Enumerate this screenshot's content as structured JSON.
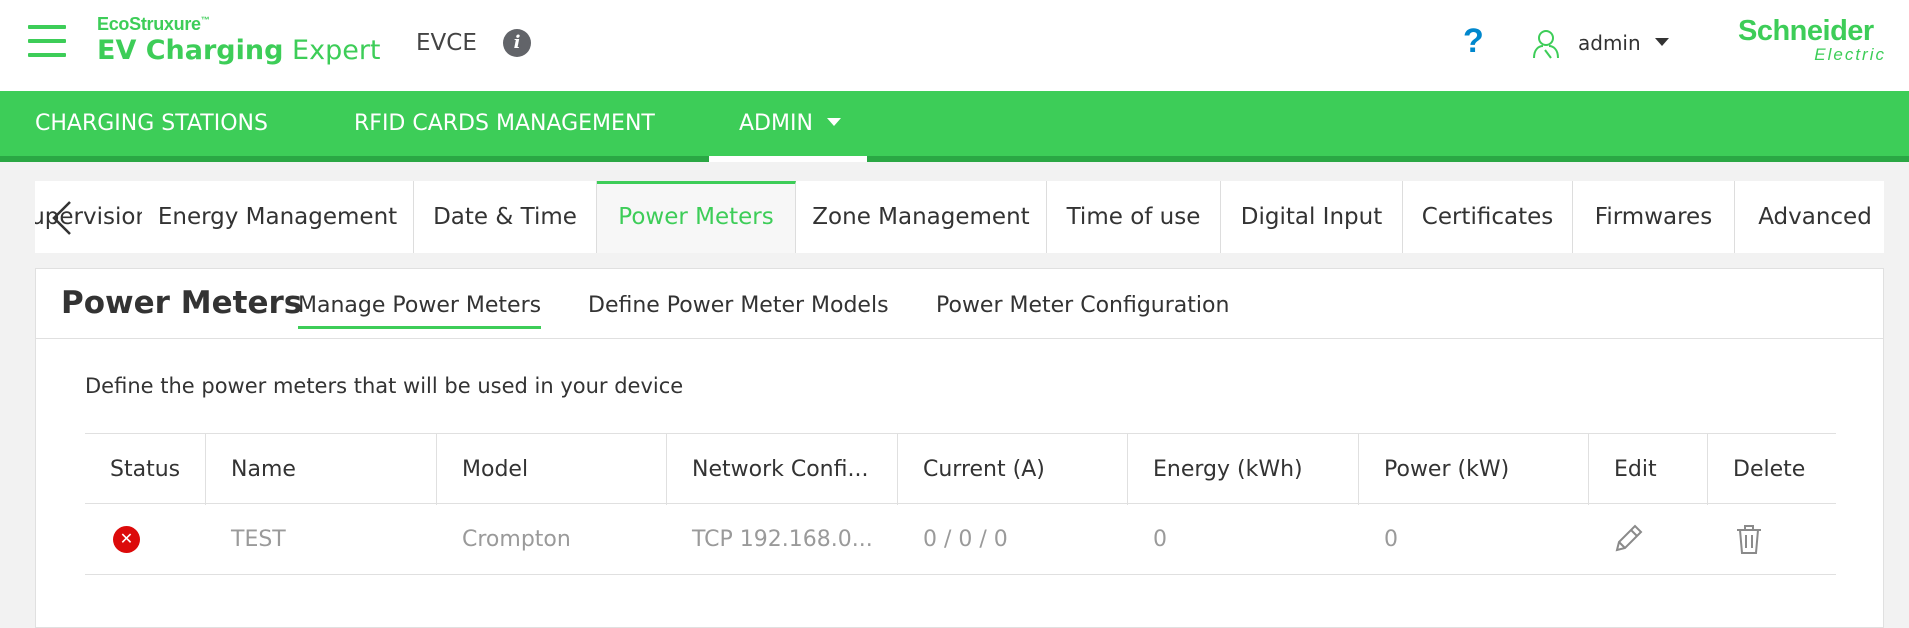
{
  "header": {
    "brand_line1": "EcoStruxure",
    "brand_tm": "™",
    "brand_product_bold": "EV Charging",
    "brand_product_light": " Expert",
    "device_name": "EVCE",
    "info_icon": "info-icon",
    "help_icon": "question-mark-icon",
    "help_glyph": "?",
    "user_name": "admin",
    "vendor_logo_line1": "Schneider",
    "vendor_logo_line2": "Electric",
    "accent_color": "#3dcd58"
  },
  "nav": {
    "items": [
      {
        "label": "CHARGING STATIONS"
      },
      {
        "label": "RFID CARDS MANAGEMENT"
      },
      {
        "label": "ADMIN",
        "active": true
      }
    ]
  },
  "tabs": {
    "items": [
      {
        "label": "Supervision"
      },
      {
        "label": "Energy Management"
      },
      {
        "label": "Date & Time"
      },
      {
        "label": "Power Meters",
        "active": true
      },
      {
        "label": "Zone Management"
      },
      {
        "label": "Time of use"
      },
      {
        "label": "Digital Input"
      },
      {
        "label": "Certificates"
      },
      {
        "label": "Firmwares"
      },
      {
        "label": "Advanced"
      }
    ]
  },
  "panel": {
    "title": "Power Meters",
    "subtabs": [
      {
        "label": "Manage Power Meters",
        "active": true
      },
      {
        "label": "Define Power Meter Models"
      },
      {
        "label": "Power Meter Configuration"
      }
    ],
    "description": "Define the power meters that will be used in your device"
  },
  "table": {
    "columns": [
      "Status",
      "Name",
      "Model",
      "Network Confi...",
      "Current (A)",
      "Energy (kWh)",
      "Power (kW)",
      "Edit",
      "Delete"
    ],
    "rows": [
      {
        "status": "error",
        "status_glyph": "✕",
        "name": "TEST",
        "model": "Crompton",
        "network": "TCP 192.168.0...",
        "current": "0 / 0 / 0",
        "energy": "0",
        "power": "0"
      }
    ],
    "error_color": "#dc0a0a"
  }
}
